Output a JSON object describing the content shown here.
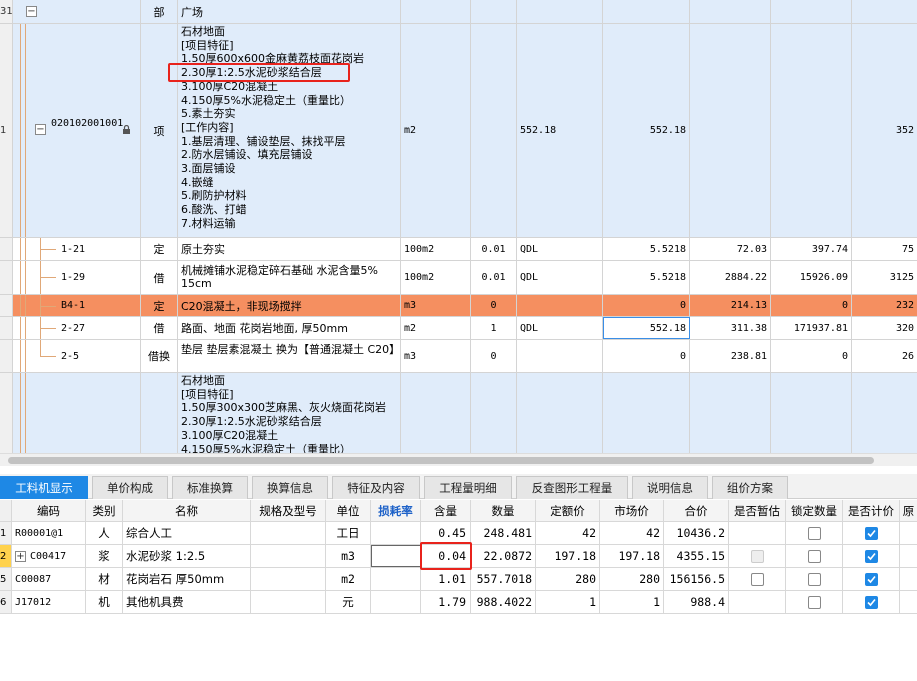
{
  "top_grid": {
    "row_header": {
      "index": "31",
      "type": "部",
      "name": "广场"
    },
    "item_row": {
      "index": "1",
      "code": "020102001001",
      "type": "项",
      "name_lines": "石材地面\n[项目特征]\n1.50厚600x600金麻黄荔枝面花岗岩\n2.30厚1:2.5水泥砂浆结合层\n3.100厚C20混凝土\n4.150厚5%水泥稳定土（重量比）\n5.素土夯实\n[工作内容]\n1.基层清理、铺设垫层、抹找平层\n2.防水层铺设、填充层铺设\n3.面层铺设\n4.嵌缝\n5.刷防护材料\n6.酸洗、打蜡\n7.材料运输",
      "unit": "m2",
      "expr": "552.18",
      "qty": "552.18",
      "last": "352"
    },
    "sub_rows": [
      {
        "code": "1-21",
        "type": "定",
        "name": "原土夯实",
        "unit": "100m2",
        "qty1": "0.01",
        "expr": "QDL",
        "qty": "5.5218",
        "price": "72.03",
        "total": "397.74",
        "last": "75"
      },
      {
        "code": "1-29",
        "type": "借",
        "name": "机械摊铺水泥稳定碎石基础 水泥含量5% 15cm",
        "unit": "100m2",
        "qty1": "0.01",
        "expr": "QDL",
        "qty": "5.5218",
        "price": "2884.22",
        "total": "15926.09",
        "last": "3125"
      },
      {
        "code": "B4-1",
        "type": "定",
        "name": "C20混凝土，非现场搅拌",
        "unit": "m3",
        "qty1": "0",
        "expr": "",
        "qty": "0",
        "price": "214.13",
        "total": "0",
        "last": "232"
      },
      {
        "code": "2-27",
        "type": "借",
        "name": "路面、地面 花岗岩地面, 厚50mm",
        "unit": "m2",
        "qty1": "1",
        "expr": "QDL",
        "qty": "552.18",
        "price": "311.38",
        "total": "171937.81",
        "last": "320"
      },
      {
        "code": "2-5",
        "type": "借换",
        "name": "垫层 垫层素混凝土  换为【普通混凝土 C20】",
        "unit": "m3",
        "qty1": "0",
        "expr": "",
        "qty": "0",
        "price": "238.81",
        "total": "0",
        "last": "26"
      }
    ],
    "next_item_lines": "石材地面\n[项目特征]\n1.50厚300x300芝麻黑、灰火烧面花岗岩\n2.30厚1:2.5水泥砂浆结合层\n3.100厚C20混凝土\n4.150厚5%水泥稳定土（重量比）"
  },
  "tabs": [
    {
      "label": "工料机显示",
      "active": true
    },
    {
      "label": "单价构成"
    },
    {
      "label": "标准换算"
    },
    {
      "label": "换算信息"
    },
    {
      "label": "特征及内容"
    },
    {
      "label": "工程量明细"
    },
    {
      "label": "反查图形工程量"
    },
    {
      "label": "说明信息"
    },
    {
      "label": "组价方案"
    }
  ],
  "bottom_grid": {
    "headers": [
      "编码",
      "类别",
      "名称",
      "规格及型号",
      "单位",
      "损耗率",
      "含量",
      "数量",
      "定额价",
      "市场价",
      "合价",
      "是否暂估",
      "锁定数量",
      "是否计价",
      "原"
    ],
    "rows": [
      {
        "index": "1",
        "code": "R00001@1",
        "cat": "人",
        "name": "综合人工",
        "spec": "",
        "unit": "工日",
        "loss": "",
        "content": "0.45",
        "qty": "248.481",
        "quota": "42",
        "market": "42",
        "sum": "10436.2",
        "temp": "",
        "lock": "off",
        "count": "on"
      },
      {
        "index": "2",
        "code": "C00417",
        "cat": "浆",
        "name": "水泥砂浆 1:2.5",
        "spec": "",
        "unit": "m3",
        "loss": "",
        "content": "0.04",
        "qty": "22.0872",
        "quota": "197.18",
        "market": "197.18",
        "sum": "4355.15",
        "temp": "disabled",
        "lock": "off",
        "count": "on"
      },
      {
        "index": "5",
        "code": "C00087",
        "cat": "材",
        "name": "花岗岩石 厚50mm",
        "spec": "",
        "unit": "m2",
        "loss": "",
        "content": "1.01",
        "qty": "557.7018",
        "quota": "280",
        "market": "280",
        "sum": "156156.5",
        "temp": "off",
        "lock": "off",
        "count": "on"
      },
      {
        "index": "6",
        "code": "J17012",
        "cat": "机",
        "name": "其他机具费",
        "spec": "",
        "unit": "元",
        "loss": "",
        "content": "1.79",
        "qty": "988.4022",
        "quota": "1",
        "market": "1",
        "sum": "988.4",
        "temp": "",
        "lock": "off",
        "count": "on"
      }
    ]
  },
  "colors": {
    "item_bg": "#e0ecfa",
    "highlight_row": "#f58f60",
    "tab_active": "#1e88e5",
    "annotation": "#e8231c"
  }
}
